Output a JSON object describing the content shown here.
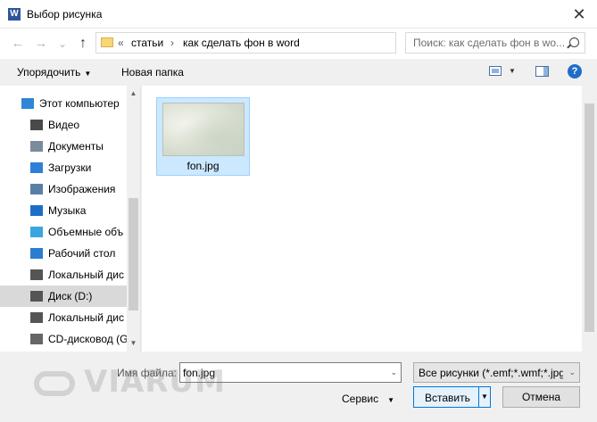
{
  "window": {
    "title": "Выбор рисунка",
    "app_icon": "W",
    "close": "✕"
  },
  "nav": {
    "back": "←",
    "forward": "→",
    "recent": "⌄",
    "up": "↑",
    "breadcrumb": {
      "overflow": "«",
      "items": [
        "статьи",
        "как сделать фон в word"
      ],
      "separator": "›"
    },
    "dropdown": "⌄",
    "refresh": "⟳"
  },
  "search": {
    "placeholder": "Поиск: как сделать фон в wo..."
  },
  "toolbar": {
    "organize_label": "Упорядочить",
    "organize_arrow": "▼",
    "new_folder_label": "Новая папка",
    "view_arrow": "▼",
    "help": "?"
  },
  "sidebar": {
    "items": [
      {
        "label": "Этот компьютер",
        "icon": "computer-icon",
        "color": "#2f86d6"
      },
      {
        "label": "Видео",
        "icon": "video-icon",
        "color": "#4a4a4a"
      },
      {
        "label": "Документы",
        "icon": "documents-icon",
        "color": "#7a8b9c"
      },
      {
        "label": "Загрузки",
        "icon": "downloads-icon",
        "color": "#2f7fd6"
      },
      {
        "label": "Изображения",
        "icon": "pictures-icon",
        "color": "#5a7fa5"
      },
      {
        "label": "Музыка",
        "icon": "music-icon",
        "color": "#1e6ec8"
      },
      {
        "label": "Объемные объ",
        "icon": "3d-objects-icon",
        "color": "#3aa6e0"
      },
      {
        "label": "Рабочий стол",
        "icon": "desktop-icon",
        "color": "#2a7dd1"
      },
      {
        "label": "Локальный дис",
        "icon": "drive-icon",
        "color": "#555555"
      },
      {
        "label": "Диск (D:)",
        "icon": "drive-icon",
        "color": "#555555",
        "selected": true
      },
      {
        "label": "Локальный дис",
        "icon": "drive-icon",
        "color": "#555555"
      },
      {
        "label": "CD-дисковод (G",
        "icon": "cd-drive-icon",
        "color": "#666666"
      }
    ],
    "scroll_up": "▲",
    "scroll_down": "▼"
  },
  "files": [
    {
      "name": "fon.jpg",
      "selected": true
    }
  ],
  "footer": {
    "filename_label": "Имя файла:",
    "filename_value": "fon.jpg",
    "dropdown": "⌄",
    "filter_value": "Все рисунки (*.emf;*.wmf;*.jpg",
    "tools_label": "Сервис",
    "tools_arrow": "▼",
    "insert_label": "Вставить",
    "insert_arrow": "▼",
    "cancel_label": "Отмена"
  },
  "watermark": {
    "text": "VIARUM"
  }
}
